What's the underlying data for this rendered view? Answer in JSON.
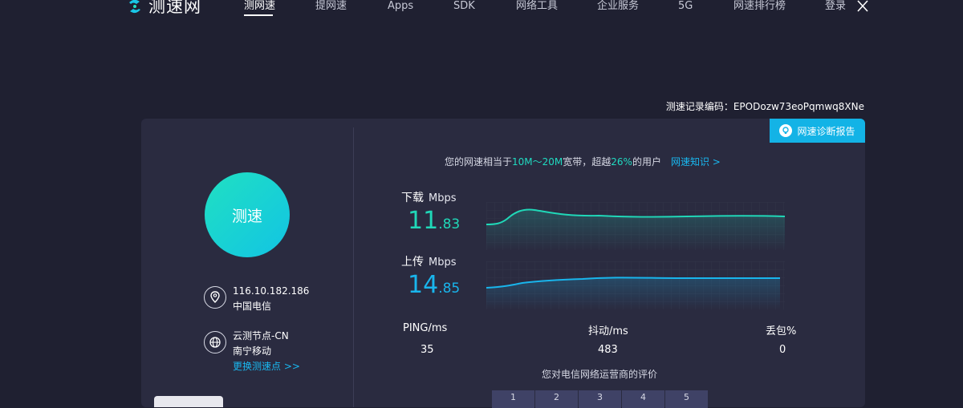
{
  "header": {
    "logo_text": "测速网",
    "nav": [
      "测网速",
      "提网速",
      "Apps",
      "SDK",
      "网络工具",
      "企业服务",
      "5G",
      "网速排行榜"
    ],
    "login": "登录"
  },
  "record": "测速记录编码：EPODozw73eoPqmwq8XNe",
  "diagnose_button": "网速诊断报告",
  "start_button": "测速",
  "client": {
    "ip": "116.10.182.186",
    "isp": "中国电信"
  },
  "node": {
    "name": "云测节点-CN",
    "location": "南宁移动",
    "change_link": "更换测速点 >>"
  },
  "summary": {
    "prefix": "您的网速相当于",
    "bandwidth": "10M～20M",
    "mid": "宽带，超越",
    "percent": "26%",
    "suffix": "的用户",
    "knowledge_link": "网速知识 >"
  },
  "download": {
    "label": "下载",
    "unit": "Mbps",
    "int": "11",
    "dec": ".83",
    "color": "#20d8b8"
  },
  "upload": {
    "label": "上传",
    "unit": "Mbps",
    "int": "14",
    "dec": ".85",
    "color": "#19b5ec"
  },
  "stats": {
    "ping_label": "PING/ms",
    "ping": "35",
    "jitter_label": "抖动/ms",
    "jitter": "483",
    "loss_label": "丢包%",
    "loss": "0"
  },
  "rating": {
    "title": "您对电信网络运营商的评价",
    "options": [
      "1",
      "2",
      "3",
      "4",
      "5"
    ]
  },
  "colors": {
    "background": "#1f2031",
    "card": "#2a2b40",
    "accent": "#13b3e6"
  }
}
